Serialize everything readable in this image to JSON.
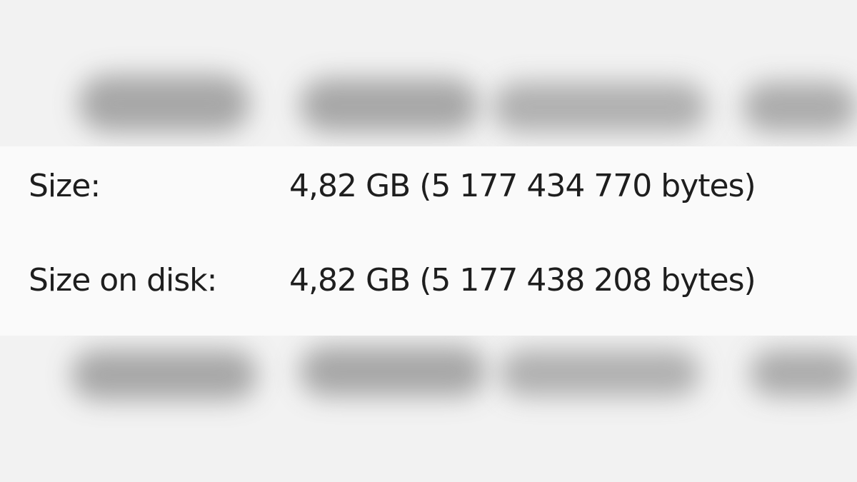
{
  "properties": {
    "size": {
      "label": "Size:",
      "value": "4,82 GB (5 177 434 770 bytes)"
    },
    "size_on_disk": {
      "label": "Size on disk:",
      "value": "4,82 GB (5 177 438 208 bytes)"
    }
  }
}
